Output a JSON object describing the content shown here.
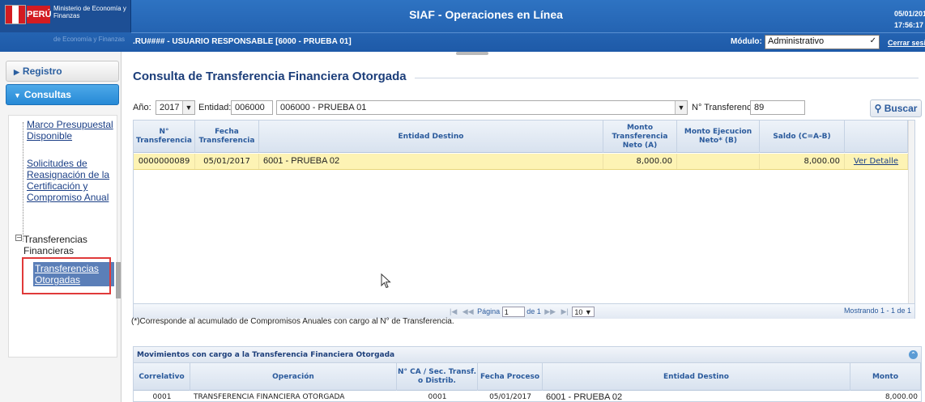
{
  "header": {
    "logo_peru": "PERÚ",
    "logo_ministry": "Ministerio de Economía y Finanzas",
    "logo_sub": "de Economía y Finanzas",
    "app_title": "SIAF - Operaciones en Línea",
    "date": "05/01/201",
    "time": "17:56:17",
    "user": ".RU#### - USUARIO RESPONSABLE [6000 - PRUEBA 01]",
    "module_label": "Módulo:",
    "module_value": "Administrativo",
    "logout": "Cerrar sesi"
  },
  "sidebar": {
    "registro": "Registro",
    "consultas": "Consultas",
    "items": [
      {
        "label": "Marco Presupuestal Disponible"
      },
      {
        "label": "Solicitudes de Reasignación de la Certificación y Compromiso Anual"
      },
      {
        "label": "Transferencias Financieras"
      },
      {
        "label": "Transferencias Otorgadas"
      }
    ]
  },
  "page": {
    "title": "Consulta de Transferencia Financiera Otorgada",
    "filters": {
      "anio_label": "Año:",
      "anio_value": "2017",
      "entidad_label": "Entidad:",
      "entidad_code": "006000",
      "entidad_name": "006000 - PRUEBA 01",
      "transf_label": "N° Transferencia:",
      "transf_value": "89",
      "buscar": "Buscar"
    },
    "grid": {
      "columns": [
        "N° Transferencia",
        "Fecha Transferencia",
        "Entidad Destino",
        "Monto Transferencia Neto (A)",
        "Monto Ejecucion Neto* (B)",
        "Saldo (C=A-B)",
        ""
      ],
      "rows": [
        {
          "num": "0000000089",
          "fecha": "05/01/2017",
          "entidad": "6001 - PRUEBA 02",
          "monto": "8,000.00",
          "ejec": "",
          "saldo": "8,000.00",
          "accion": "Ver Detalle"
        }
      ]
    },
    "pager": {
      "page_label": "Página",
      "page_value": "1",
      "of": "de 1",
      "page_size": "10",
      "showing": "Mostrando 1 - 1 de 1"
    },
    "footnote": "(*)Corresponde al acumulado de Compromisos Anuales con cargo al N° de Transferencia.",
    "movements": {
      "title": "Movimientos con cargo a la Transferencia Financiera Otorgada",
      "columns": [
        "Correlativo",
        "Operación",
        "N° CA / Sec. Transf. o Distrib.",
        "Fecha Proceso",
        "Entidad Destino",
        "Monto"
      ],
      "rows": [
        {
          "correlativo": "0001",
          "operacion": "TRANSFERENCIA FINANCIERA OTORGADA",
          "ca": "0001",
          "fecha": "05/01/2017",
          "entidad": "6001 - PRUEBA 02",
          "monto": "8,000.00"
        }
      ]
    }
  }
}
